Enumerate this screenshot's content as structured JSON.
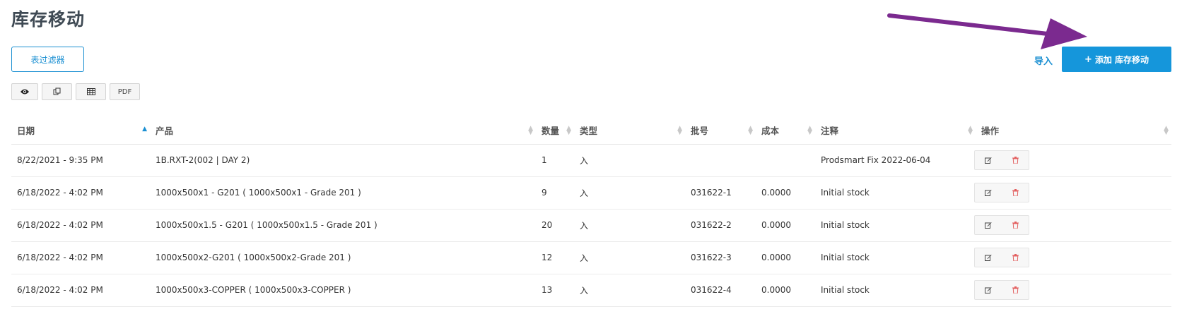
{
  "page": {
    "title": "库存移动"
  },
  "toolbar": {
    "filter_label": "表过滤器",
    "import_label": "导入",
    "add_plus": "+",
    "add_label": "添加 库存移动",
    "pdf_label": "PDF"
  },
  "colors": {
    "accent": "#1596db",
    "arrow": "#7b2a8f",
    "delete": "#e36060"
  },
  "table": {
    "headers": [
      "日期",
      "产品",
      "数量",
      "类型",
      "批号",
      "成本",
      "注释",
      "操作"
    ],
    "sort_column": "日期",
    "sort_direction": "ascending",
    "rows": [
      {
        "date": "8/22/2021 - 9:35 PM",
        "product": "1B.RXT-2(002 | DAY 2)",
        "qty": "1",
        "type": "入",
        "lot": "",
        "cost": "",
        "note": "Prodsmart Fix 2022-06-04"
      },
      {
        "date": "6/18/2022 - 4:02 PM",
        "product": "1000x500x1 - G201 ( 1000x500x1 - Grade 201 )",
        "qty": "9",
        "type": "入",
        "lot": "031622-1",
        "cost": "0.0000",
        "note": "Initial stock"
      },
      {
        "date": "6/18/2022 - 4:02 PM",
        "product": "1000x500x1.5 - G201 ( 1000x500x1.5 - Grade 201 )",
        "qty": "20",
        "type": "入",
        "lot": "031622-2",
        "cost": "0.0000",
        "note": "Initial stock"
      },
      {
        "date": "6/18/2022 - 4:02 PM",
        "product": "1000x500x2-G201 ( 1000x500x2-Grade 201 )",
        "qty": "12",
        "type": "入",
        "lot": "031622-3",
        "cost": "0.0000",
        "note": "Initial stock"
      },
      {
        "date": "6/18/2022 - 4:02 PM",
        "product": "1000x500x3-COPPER ( 1000x500x3-COPPER )",
        "qty": "13",
        "type": "入",
        "lot": "031622-4",
        "cost": "0.0000",
        "note": "Initial stock"
      }
    ]
  }
}
